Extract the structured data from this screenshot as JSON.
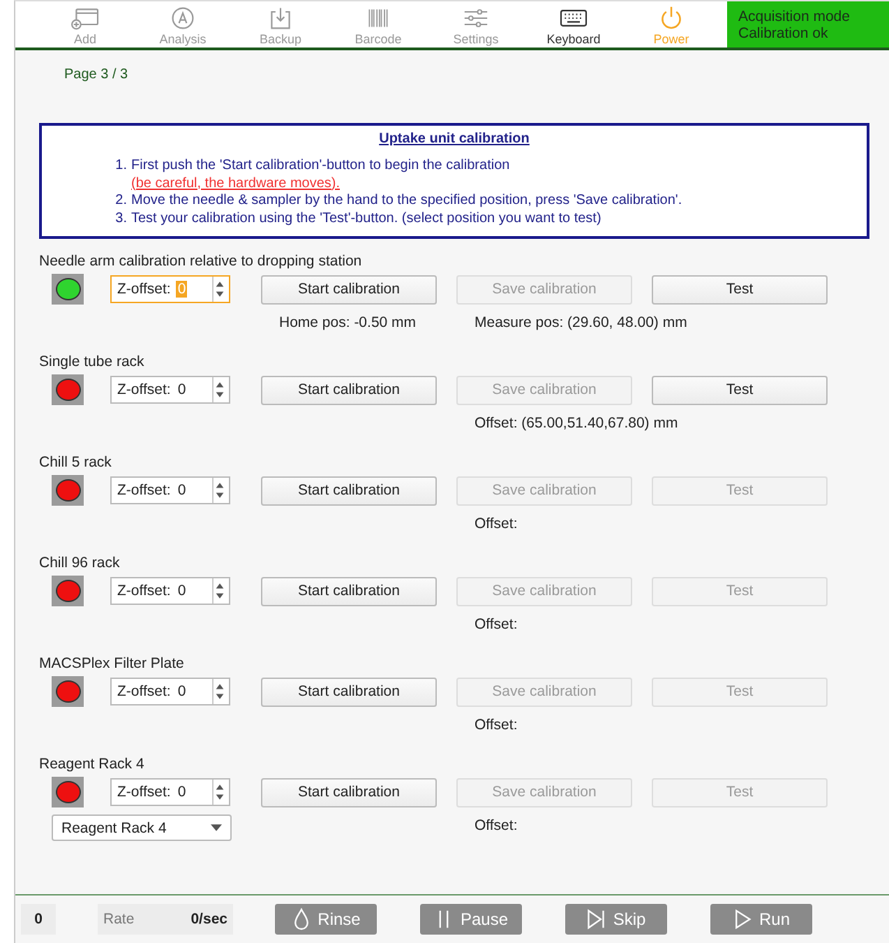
{
  "toolbar": [
    {
      "label": "Add",
      "disabled": true,
      "active": false
    },
    {
      "label": "Analysis",
      "disabled": true,
      "active": false
    },
    {
      "label": "Backup",
      "disabled": true,
      "active": false
    },
    {
      "label": "Barcode",
      "disabled": true,
      "active": false
    },
    {
      "label": "Settings",
      "disabled": true,
      "active": false
    },
    {
      "label": "Keyboard",
      "disabled": false,
      "active": false
    },
    {
      "label": "Power",
      "disabled": false,
      "active": true
    }
  ],
  "status": [
    "Acquisition mode",
    "Calibration ok"
  ],
  "page": "Page 3 / 3",
  "instructions": {
    "title": "Uptake unit calibration",
    "steps": [
      {
        "number": "1.",
        "text": "First push the 'Start calibration'-button to begin the calibration",
        "warning": "(be careful, the hardware moves)."
      },
      {
        "number": "2.",
        "text": "Move the needle & sampler by the hand to the specified position, press 'Save calibration'."
      },
      {
        "number": "3.",
        "text": "Test your calibration using the 'Test'-button. (select position you want to test)"
      }
    ]
  },
  "sections": [
    {
      "name": "Needle arm calibration relative to dropping station",
      "ok": true,
      "z_label": "Z-offset:",
      "z_value": "0",
      "focused": true,
      "start": {
        "label": "Start calibration",
        "disabled": false
      },
      "save": {
        "label": "Save calibration",
        "disabled": true
      },
      "test": {
        "label": "Test",
        "disabled": false
      },
      "info_left": "Home pos: -0.50 mm",
      "info_right": "Measure pos: (29.60, 48.00) mm"
    },
    {
      "name": "Single tube rack",
      "ok": false,
      "z_label": "Z-offset:",
      "z_value": "0",
      "focused": false,
      "start": {
        "label": "Start calibration",
        "disabled": false
      },
      "save": {
        "label": "Save calibration",
        "disabled": true
      },
      "test": {
        "label": "Test",
        "disabled": false
      },
      "info_right": "Offset: (65.00,51.40,67.80) mm"
    },
    {
      "name": "Chill 5 rack",
      "ok": false,
      "z_label": "Z-offset:",
      "z_value": "0",
      "focused": false,
      "start": {
        "label": "Start calibration",
        "disabled": false
      },
      "save": {
        "label": "Save calibration",
        "disabled": true
      },
      "test": {
        "label": "Test",
        "disabled": true
      },
      "info_right": "Offset:"
    },
    {
      "name": "Chill 96 rack",
      "ok": false,
      "z_label": "Z-offset:",
      "z_value": "0",
      "focused": false,
      "start": {
        "label": "Start calibration",
        "disabled": false
      },
      "save": {
        "label": "Save calibration",
        "disabled": true
      },
      "test": {
        "label": "Test",
        "disabled": true
      },
      "info_right": "Offset:"
    },
    {
      "name": "MACSPlex Filter Plate",
      "ok": false,
      "z_label": "Z-offset:",
      "z_value": "0",
      "focused": false,
      "start": {
        "label": "Start calibration",
        "disabled": false
      },
      "save": {
        "label": "Save calibration",
        "disabled": true
      },
      "test": {
        "label": "Test",
        "disabled": true
      },
      "info_right": "Offset:"
    },
    {
      "name": "Reagent Rack 4",
      "ok": false,
      "z_label": "Z-offset:",
      "z_value": "0",
      "focused": false,
      "start": {
        "label": "Start calibration",
        "disabled": false
      },
      "save": {
        "label": "Save calibration",
        "disabled": true
      },
      "test": {
        "label": "Test",
        "disabled": true
      },
      "info_right": "Offset:",
      "dropdown": "Reagent Rack 4"
    }
  ],
  "footer": {
    "count": "0",
    "rate_label": "Rate",
    "rate_value": "0/sec",
    "buttons": [
      {
        "label": "Rinse"
      },
      {
        "label": "Pause"
      },
      {
        "label": "Skip"
      },
      {
        "label": "Run"
      }
    ]
  }
}
